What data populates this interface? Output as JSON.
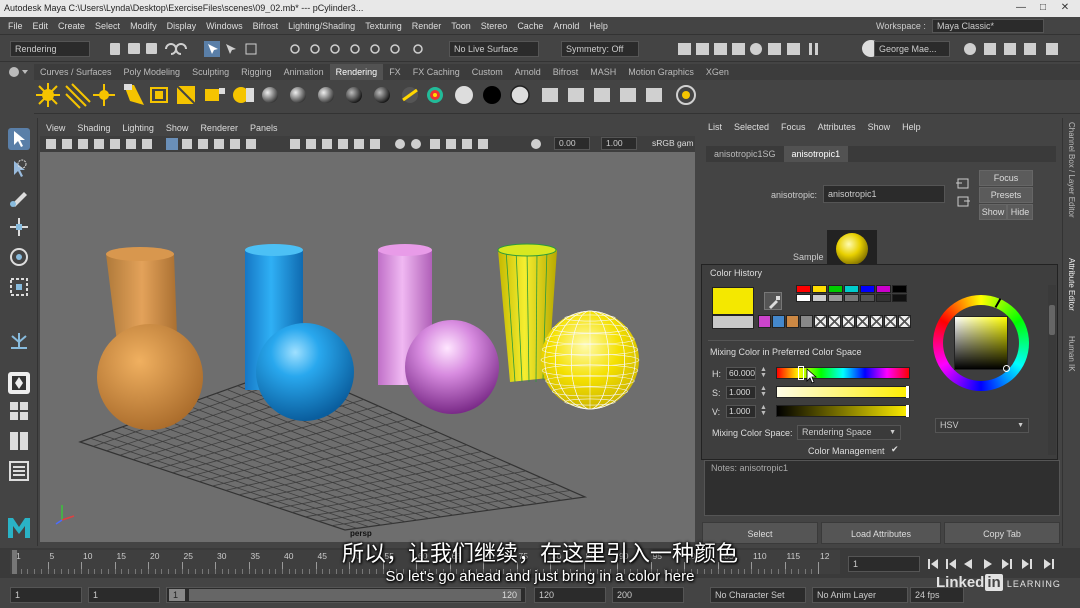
{
  "window": {
    "title": "Autodesk Maya  C:\\Users\\Lynda\\Desktop\\ExerciseFiles\\scenes\\09_02.mb*   ---   pCylinder3...",
    "controls": [
      "—",
      "□",
      "✕"
    ]
  },
  "menubar": {
    "items": [
      "File",
      "Edit",
      "Create",
      "Select",
      "Modify",
      "Display",
      "Windows",
      "Bifrost",
      "Lighting/Shading",
      "Texturing",
      "Render",
      "Toon",
      "Stereo",
      "Cache",
      "Arnold",
      "Help"
    ],
    "workspace_label": "Workspace :",
    "workspace_value": "Maya Classic*"
  },
  "statusline": {
    "menuset": "Rendering",
    "live_surface": "No Live Surface",
    "symmetry": "Symmetry: Off",
    "user": "George Mae..."
  },
  "shelf": {
    "tabs": [
      "Curves / Surfaces",
      "Poly Modeling",
      "Sculpting",
      "Rigging",
      "Animation",
      "Rendering",
      "FX",
      "FX Caching",
      "Custom",
      "Arnold",
      "Bifrost",
      "MASH",
      "Motion Graphics",
      "XGen"
    ],
    "active_tab": "Rendering"
  },
  "viewport": {
    "menu": [
      "View",
      "Shading",
      "Lighting",
      "Show",
      "Renderer",
      "Panels"
    ],
    "exposure": "0.00",
    "gamma": "1.00",
    "colorspace": "sRGB gam",
    "camera_label": "persp"
  },
  "attribute_editor": {
    "menu": [
      "List",
      "Selected",
      "Focus",
      "Attributes",
      "Show",
      "Help"
    ],
    "tabs": [
      "anisotropic1SG",
      "anisotropic1"
    ],
    "active_tab": "anisotropic1",
    "type_label": "anisotropic:",
    "node_name": "anisotropic1",
    "buttons": {
      "focus": "Focus",
      "presets": "Presets",
      "show": "Show",
      "hide": "Hide"
    },
    "sample_label": "Sample",
    "notes_label": "Notes:  anisotropic1",
    "bottom_buttons": [
      "Select",
      "Load Attributes",
      "Copy Tab"
    ]
  },
  "sidebar": {
    "tabs": [
      "Channel Box / Layer Editor",
      "Attribute Editor",
      "Human IK"
    ]
  },
  "color_chooser": {
    "history_label": "Color History",
    "mixing_label": "Mixing Color in Preferred Color Space",
    "h_label": "H:",
    "h_value": "60.000",
    "s_label": "S:",
    "s_value": "1.000",
    "v_label": "V:",
    "v_value": "1.000",
    "mixing_space_label": "Mixing Color Space:",
    "mixing_space_value": "Rendering Space",
    "color_management_label": "Color Management",
    "color_management_check": "✔",
    "wheel_mode": "HSV",
    "current_color": "#f4e800",
    "previous_color": "#c8c8c8",
    "swatches_row1": [
      "#ff0000",
      "#ffdd00",
      "#00cc00",
      "#00cccc",
      "#0000ff",
      "#cc00cc",
      "#000000"
    ],
    "swatches_row2": [
      "#ffffff",
      "#cccccc",
      "#999999",
      "#777777",
      "#555555",
      "#333333",
      "#111111"
    ],
    "swatches_row3": [
      "#cc44cc",
      "#4488cc",
      "#cc8844",
      "#888888"
    ]
  },
  "timeline": {
    "ticks": [
      "1",
      "5",
      "10",
      "15",
      "20",
      "25",
      "30",
      "35",
      "40",
      "45",
      "50",
      "55",
      "60",
      "65",
      "70",
      "75",
      "80",
      "85",
      "90",
      "95",
      "100",
      "105",
      "110",
      "115",
      "12"
    ],
    "current_frame": "1",
    "range_start_outer": "1",
    "range_start_inner": "1",
    "range_slider_start": "1",
    "range_slider_end": "120",
    "range_end_inner": "120",
    "range_end_outer": "200",
    "character_set": "No Character Set",
    "anim_layer": "No Anim Layer",
    "fps": "24 fps"
  },
  "subtitles": {
    "chinese": "所以，让我们继续，在这里引入一种颜色",
    "english": "So let's go ahead and just bring in a color here"
  },
  "watermark": {
    "brand": "Linked",
    "brand_in": "in",
    "learning": "LEARNING"
  }
}
